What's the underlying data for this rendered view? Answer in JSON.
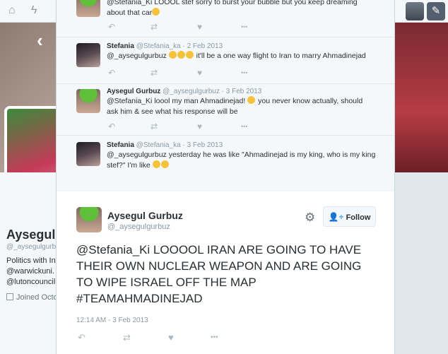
{
  "topbar": {
    "home_icon": "home-icon",
    "moments_icon": "lightning-icon",
    "compose_icon": "compose-icon"
  },
  "profile": {
    "name": "Aysegul G",
    "handle": "@_aysegulgurb",
    "bio": [
      "Politics with Int",
      "@warwickuni. Y",
      "@lutoncouncil."
    ],
    "joined": "Joined Octo"
  },
  "conversation": [
    {
      "name": "",
      "handle": "",
      "date": "",
      "text_lines": [
        "@Stefania_Ki LOOOL stef sorry to burst your bubble but you keep dreaming",
        "about that car"
      ],
      "emoji_after": 1
    },
    {
      "name": "Stefania",
      "handle": "@Stefania_ka",
      "date": "2 Feb 2013",
      "text_before": "@_aysegulgurbuz",
      "emoji_count": 3,
      "text_after": "it'll be a one way flight to Iran to marry Ahmadinejad"
    },
    {
      "name": "Aysegul Gurbuz",
      "handle": "@_aysegulgurbuz",
      "date": "3 Feb 2013",
      "text_line1_before": "@Stefania_Ki loool my man Ahmadinejad!",
      "text_line1_after": "you never know actually, should",
      "text_line2": "ask him & see what his response will be"
    },
    {
      "name": "Stefania",
      "handle": "@Stefania_ka",
      "date": "3 Feb 2013",
      "text_line1": "@_aysegulgurbuz yesterday he was like \"Ahmadinejad is my king, who is my king",
      "text_line2": "stef?\" I'm like"
    }
  ],
  "main_tweet": {
    "name": "Aysegul Gurbuz",
    "handle": "@_aysegulgurbuz",
    "follow_label": "Follow",
    "text": "@Stefania_Ki LOOOOL IRAN ARE GOING TO HAVE THEIR OWN NUCLEAR WEAPON AND ARE GOING TO WIPE ISRAEL OFF THE MAP #TEAMAHMADINEJAD",
    "timestamp": "12:14 AM - 3 Feb 2013"
  },
  "icons": {
    "reply": "↶",
    "retweet": "⇄",
    "like": "♥",
    "more": "•••",
    "gear": "⚙",
    "back": "‹"
  },
  "colors": {
    "accent": "#55acee",
    "muted": "#8899a6"
  }
}
